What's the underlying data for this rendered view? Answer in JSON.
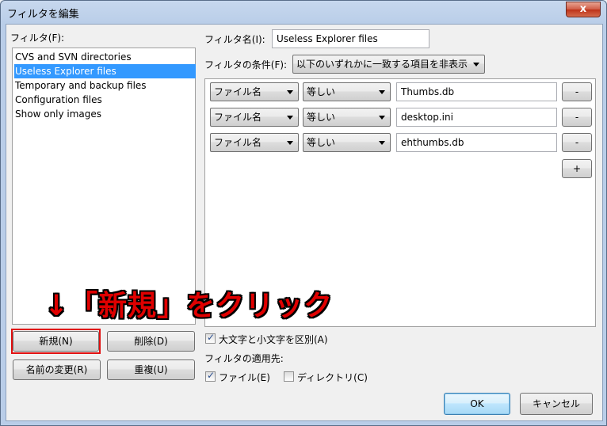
{
  "window": {
    "title": "フィルタを編集",
    "close_glyph": "x"
  },
  "filters": {
    "label": "フィルタ(F):",
    "items": [
      {
        "label": "CVS and SVN directories"
      },
      {
        "label": "Useless Explorer files",
        "selected": true
      },
      {
        "label": "Temporary and backup files"
      },
      {
        "label": "Configuration files"
      },
      {
        "label": "Show only images"
      }
    ]
  },
  "buttons": {
    "new": "新規(N)",
    "delete": "削除(D)",
    "rename": "名前の変更(R)",
    "duplicate": "重複(U)",
    "ok": "OK",
    "cancel": "キャンセル"
  },
  "filter_name": {
    "label": "フィルタ名(I):",
    "value": "Useless Explorer files"
  },
  "condition": {
    "label": "フィルタの条件(F):",
    "value": "以下のいずれかに一致する項目を非表示"
  },
  "rules": [
    {
      "field": "ファイル名",
      "operator": "等しい",
      "value": "Thumbs.db",
      "remove": "-"
    },
    {
      "field": "ファイル名",
      "operator": "等しい",
      "value": "desktop.ini",
      "remove": "-"
    },
    {
      "field": "ファイル名",
      "operator": "等しい",
      "value": "ehthumbs.db",
      "remove": "-"
    }
  ],
  "add_rule": "+",
  "options": {
    "case_sensitive": {
      "label": "大文字と小文字を区別(A)",
      "checked": true
    },
    "apply_to_label": "フィルタの適用先:",
    "files": {
      "label": "ファイル(E)",
      "checked": true
    },
    "directories": {
      "label": "ディレクトリ(C)",
      "checked": false
    }
  },
  "annotation": "↓「新規」をクリック",
  "colors": {
    "selection": "#3399ff",
    "annotation": "#e00000",
    "highlight_border": "#e01010"
  }
}
